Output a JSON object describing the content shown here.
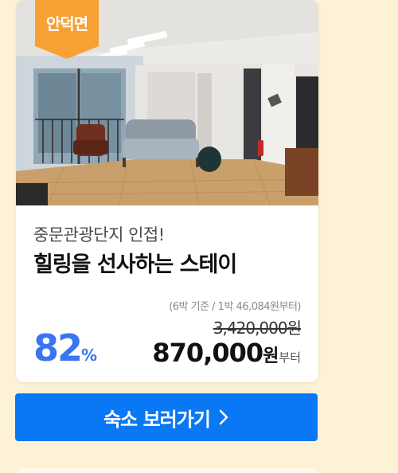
{
  "badge": {
    "label": "안덕면",
    "color": "#f7a034"
  },
  "listing": {
    "subtitle": "중문관광단지 인접!",
    "title": "힐링을 선사하는 스테이",
    "photo_alt": "living-room-photo"
  },
  "pricing": {
    "note": "(6박 기준 / 1박 46,084원부터)",
    "original_price": "3,420,000원",
    "discount_number": "82",
    "discount_unit": "%",
    "price_amount": "870,000",
    "price_unit": "원",
    "price_suffix": "부터"
  },
  "cta": {
    "label": "숙소 보러가기",
    "icon": "chevron-right-icon",
    "color": "#0a78f5"
  },
  "colors": {
    "background": "#fdf1d6",
    "discount": "#3a74f0"
  }
}
